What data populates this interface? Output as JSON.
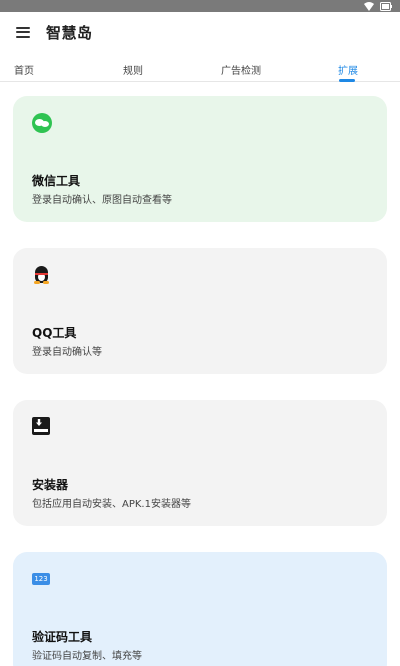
{
  "app": {
    "title": "智慧岛"
  },
  "tabs": [
    {
      "label": "首页"
    },
    {
      "label": "规则"
    },
    {
      "label": "广告检测"
    },
    {
      "label": "扩展"
    }
  ],
  "active_tab": "扩展",
  "cards": [
    {
      "title": "微信工具",
      "desc": "登录自动确认、原图自动查看等",
      "icon": "wechat-icon",
      "bg": "#e8f6ea"
    },
    {
      "title": "QQ工具",
      "desc": "登录自动确认等",
      "icon": "qq-icon",
      "bg": "#f3f3f3"
    },
    {
      "title": "安装器",
      "desc": "包括应用自动安装、APK.1安装器等",
      "icon": "download-box-icon",
      "bg": "#f3f3f3"
    },
    {
      "title": "验证码工具",
      "desc": "验证码自动复制、填充等",
      "icon": "123-icon",
      "icon_text": "123",
      "bg": "#e3f0fc"
    }
  ],
  "colors": {
    "accent": "#1e88e5",
    "status_bar": "#7a7a7a"
  }
}
